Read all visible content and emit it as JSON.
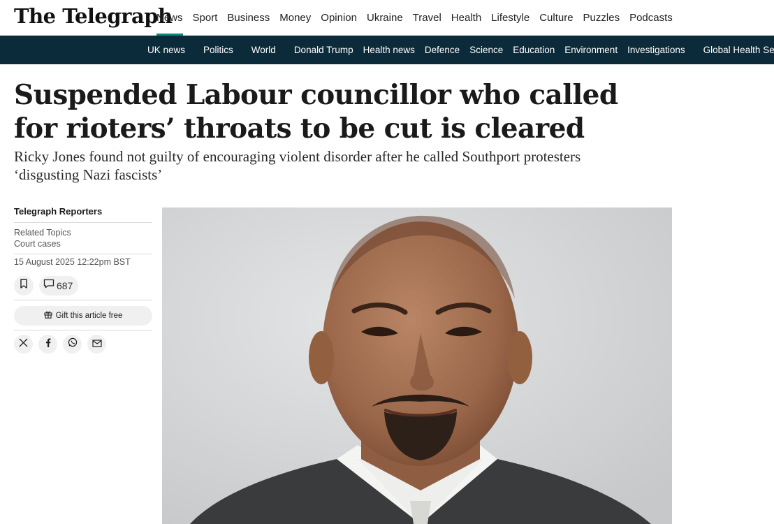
{
  "brand": {
    "logo_text": "The Telegraph"
  },
  "main_nav": [
    {
      "label": "News"
    },
    {
      "label": "Sport"
    },
    {
      "label": "Business"
    },
    {
      "label": "Money"
    },
    {
      "label": "Opinion"
    },
    {
      "label": "Ukraine"
    },
    {
      "label": "Travel"
    },
    {
      "label": "Health"
    },
    {
      "label": "Lifestyle"
    },
    {
      "label": "Culture"
    },
    {
      "label": "Puzzles"
    },
    {
      "label": "Podcasts"
    }
  ],
  "sub_nav": [
    {
      "label": "UK news"
    },
    {
      "label": "Politics"
    },
    {
      "label": "World"
    },
    {
      "label": "Donald Trump"
    },
    {
      "label": "Health news"
    },
    {
      "label": "Defence"
    },
    {
      "label": "Science"
    },
    {
      "label": "Education"
    },
    {
      "label": "Environment"
    },
    {
      "label": "Investigations"
    },
    {
      "label": "Global Health Security"
    }
  ],
  "article": {
    "headline": "Suspended Labour councillor who called for rioters’ throats to be cut is cleared",
    "standfirst": "Ricky Jones found not guilty of encouraging violent disorder after he called Southport protesters ‘disgusting Nazi fascists’",
    "author": "Telegraph Reporters",
    "related_label": "Related Topics",
    "related_topic": "Court cases",
    "date": "15 August 2025 12:22pm BST",
    "comment_count": "687",
    "gift_label": "Gift this article free"
  },
  "icons": {
    "bookmark": "bookmark-icon",
    "comment": "comment-icon",
    "gift": "gift-icon",
    "share": [
      "x-icon",
      "facebook-icon",
      "whatsapp-icon",
      "email-icon"
    ]
  },
  "colors": {
    "accent": "#0e8577",
    "subnav_bg": "#0b2a3a"
  }
}
